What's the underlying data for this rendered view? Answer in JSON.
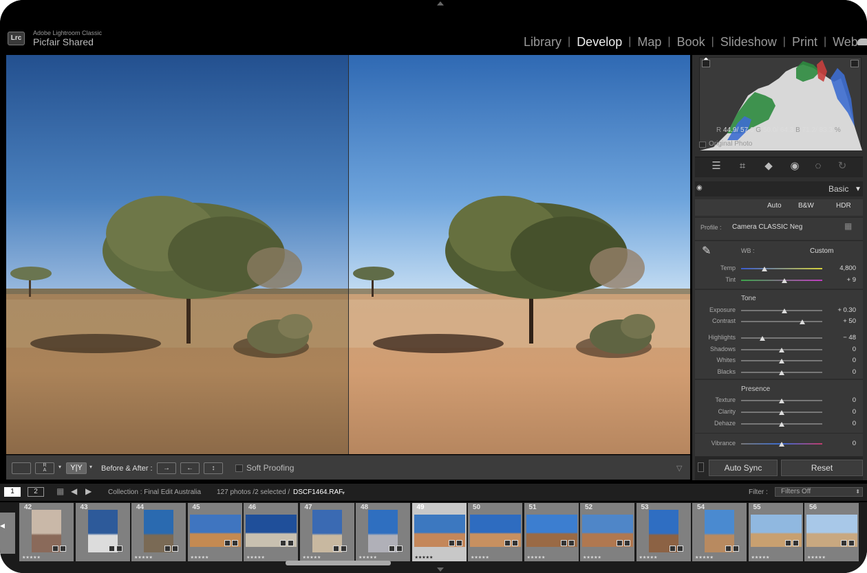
{
  "app": {
    "product": "Adobe Lightroom Classic",
    "catalog": "Picfair Shared",
    "logo": "Lrc"
  },
  "modules": [
    {
      "label": "Library",
      "active": false
    },
    {
      "label": "Develop",
      "active": true
    },
    {
      "label": "Map",
      "active": false
    },
    {
      "label": "Book",
      "active": false
    },
    {
      "label": "Slideshow",
      "active": false
    },
    {
      "label": "Print",
      "active": false
    },
    {
      "label": "Web",
      "active": false
    }
  ],
  "toolbar": {
    "before_after_label": "Before & After :",
    "soft_proofing_label": "Soft Proofing",
    "view_ra_label": "R\nA",
    "view_yy_label": "Y|Y"
  },
  "histogram": {
    "r_label": "R",
    "r_value": "44.9/ 57.6",
    "g_label": "G",
    "g_value": "50.0/ 64.3",
    "b_label": "B",
    "b_value": "71.2/ 83.3",
    "pct": "%",
    "original_photo_label": "Original Photo"
  },
  "panel": {
    "title": "Basic",
    "mode_buttons": [
      "Auto",
      "B&W",
      "HDR"
    ],
    "profile_label": "Profile :",
    "profile_value": "Camera CLASSIC Neg",
    "wb_label": "WB :",
    "wb_value": "Custom",
    "tone_header": "Tone",
    "presence_header": "Presence",
    "sliders": [
      {
        "label": "Temp",
        "value": "4,800",
        "pos": 0.29
      },
      {
        "label": "Tint",
        "value": "+ 9",
        "pos": 0.53
      },
      {
        "label": "Exposure",
        "value": "+ 0.30",
        "pos": 0.53
      },
      {
        "label": "Contrast",
        "value": "+ 50",
        "pos": 0.75
      },
      {
        "label": "Highlights",
        "value": "− 48",
        "pos": 0.26
      },
      {
        "label": "Shadows",
        "value": "0",
        "pos": 0.5
      },
      {
        "label": "Whites",
        "value": "0",
        "pos": 0.5
      },
      {
        "label": "Blacks",
        "value": "0",
        "pos": 0.5
      },
      {
        "label": "Texture",
        "value": "0",
        "pos": 0.5
      },
      {
        "label": "Clarity",
        "value": "0",
        "pos": 0.5
      },
      {
        "label": "Dehaze",
        "value": "0",
        "pos": 0.5
      },
      {
        "label": "Vibrance",
        "value": "0",
        "pos": 0.5
      }
    ],
    "auto_sync_label": "Auto Sync",
    "reset_label": "Reset"
  },
  "filmstrip_bar": {
    "screen1": "1",
    "screen2": "2",
    "collection_label": "Collection : Final Edit Australia",
    "count_label": "127 photos /2 selected /",
    "filename": "DSCF1464.RAF",
    "filter_label": "Filter :",
    "filter_value": "Filters Off"
  },
  "filmstrip": [
    {
      "num": "42",
      "rated": true
    },
    {
      "num": "43",
      "rated": false
    },
    {
      "num": "44",
      "rated": true
    },
    {
      "num": "45",
      "rated": true
    },
    {
      "num": "46",
      "rated": true
    },
    {
      "num": "47",
      "rated": true
    },
    {
      "num": "48",
      "rated": true
    },
    {
      "num": "49",
      "rated": true,
      "selected": true
    },
    {
      "num": "50",
      "rated": true
    },
    {
      "num": "51",
      "rated": true
    },
    {
      "num": "52",
      "rated": true
    },
    {
      "num": "53",
      "rated": true
    },
    {
      "num": "54",
      "rated": true
    },
    {
      "num": "55",
      "rated": true
    },
    {
      "num": "56",
      "rated": true
    }
  ],
  "stars_text": "★★★★★"
}
